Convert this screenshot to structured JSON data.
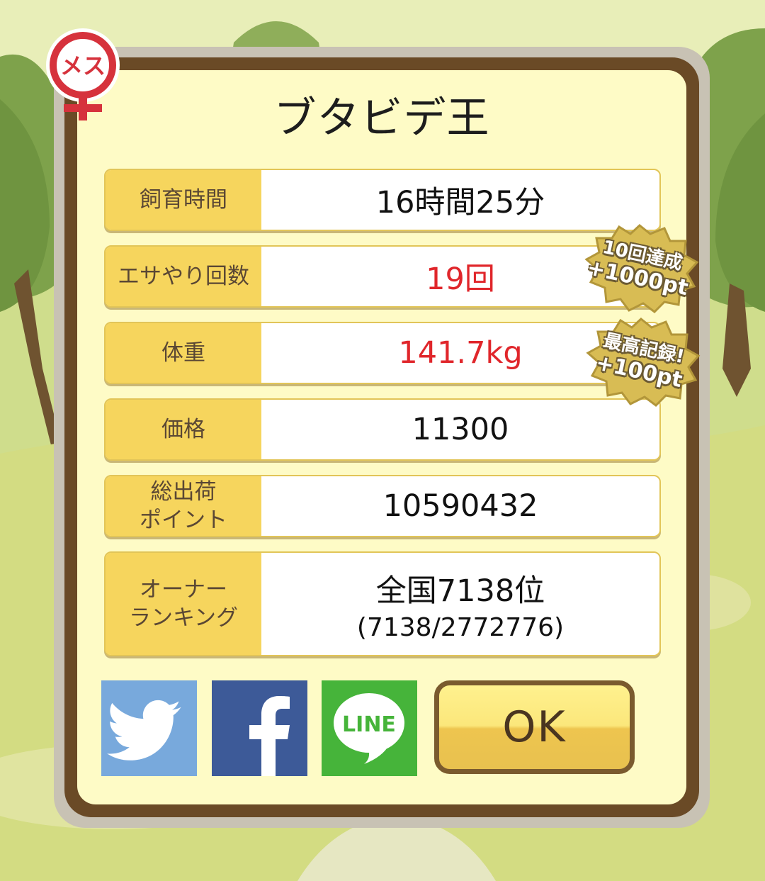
{
  "pig": {
    "gender_label": "メス",
    "name": "ブタビデ王"
  },
  "stats": [
    {
      "label": "飼育時間",
      "value": "16時間25分"
    },
    {
      "label": "エサやり回数",
      "value": "19回"
    },
    {
      "label": "体重",
      "value": "141.7kg"
    },
    {
      "label": "価格",
      "value": "11300"
    },
    {
      "label": "総出荷\nポイント",
      "value": "10590432"
    },
    {
      "label": "オーナー\nランキング",
      "value": "全国7138位",
      "sub": "(7138/2772776)"
    }
  ],
  "stickers": [
    {
      "line1": "10回達成",
      "line2": "+1000pt"
    },
    {
      "line1": "最高記録!",
      "line2": "+100pt"
    }
  ],
  "share": {
    "line_label": "LINE"
  },
  "ok_label": "OK",
  "colors": {
    "frame": "#6a4a26",
    "panel": "#fefbc6",
    "label_bg": "#f6d55d",
    "highlight_text": "#e0262b",
    "twitter": "#78a9dc",
    "facebook": "#3d5a98",
    "line": "#46b43a"
  },
  "icons": [
    "female-icon",
    "twitter-bird-icon",
    "facebook-f-icon",
    "line-icon"
  ]
}
